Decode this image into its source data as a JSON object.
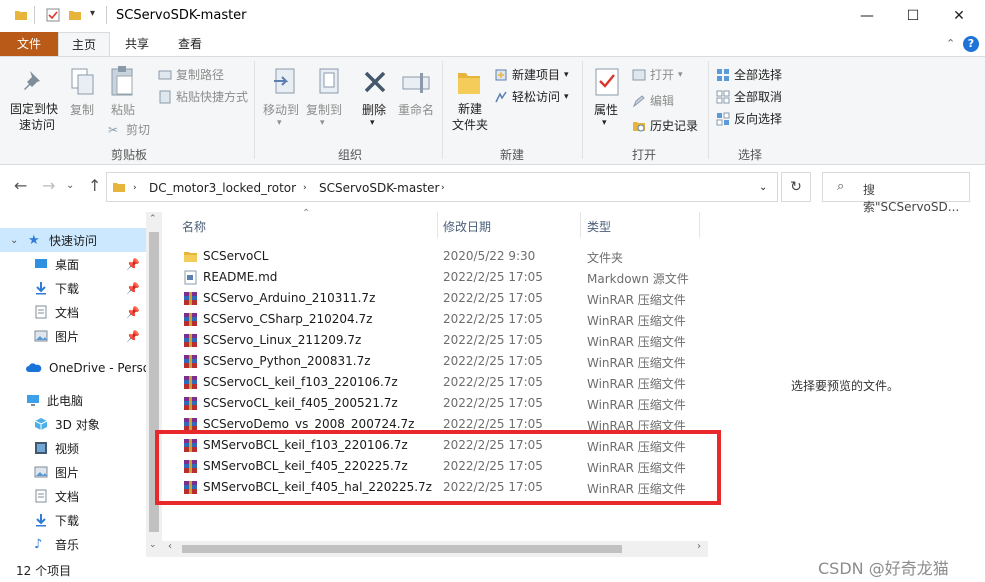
{
  "window": {
    "title": "SCServoSDK-master",
    "minimize": "—",
    "maximize": "☐",
    "close": "✕"
  },
  "ribbon_tabs": {
    "file": "文件",
    "home": "主页",
    "share": "共享",
    "view": "查看"
  },
  "ribbon": {
    "pin_quick_access": [
      "固定到快",
      "速访问"
    ],
    "copy": "复制",
    "paste": "粘贴",
    "copy_path": "复制路径",
    "paste_shortcut": "粘贴快捷方式",
    "cut": "剪切",
    "clipboard_group": "剪贴板",
    "move_to": "移动到",
    "copy_to": "复制到",
    "delete": "删除",
    "rename": "重命名",
    "organize_group": "组织",
    "new_folder": [
      "新建",
      "文件夹"
    ],
    "new_item": "新建项目",
    "easy_access": "轻松访问",
    "new_group": "新建",
    "properties": "属性",
    "open": "打开",
    "edit": "编辑",
    "history": "历史记录",
    "open_group": "打开",
    "select_all": "全部选择",
    "select_none": "全部取消",
    "invert_selection": "反向选择",
    "select_group": "选择"
  },
  "address": {
    "crumb1": "DC_motor3_locked_rotor",
    "crumb2": "SCServoSDK-master",
    "search_placeholder": "搜索\"SCServoSD..."
  },
  "sidebar": {
    "quick_access": "快速访问",
    "desktop": "桌面",
    "downloads": "下载",
    "documents": "文档",
    "pictures": "图片",
    "onedrive": "OneDrive - Perso",
    "this_pc": "此电脑",
    "objects3d": "3D 对象",
    "videos": "视频",
    "pictures2": "图片",
    "documents2": "文档",
    "downloads2": "下载",
    "music": "音乐"
  },
  "columns": {
    "name": "名称",
    "date": "修改日期",
    "type": "类型"
  },
  "files": [
    {
      "name": "SCServoCL",
      "date": "2020/5/22 9:30",
      "type": "文件夹",
      "kind": "folder"
    },
    {
      "name": "README.md",
      "date": "2022/2/25 17:05",
      "type": "Markdown 源文件",
      "kind": "doc"
    },
    {
      "name": "SCServo_Arduino_210311.7z",
      "date": "2022/2/25 17:05",
      "type": "WinRAR 压缩文件",
      "kind": "rar"
    },
    {
      "name": "SCServo_CSharp_210204.7z",
      "date": "2022/2/25 17:05",
      "type": "WinRAR 压缩文件",
      "kind": "rar"
    },
    {
      "name": "SCServo_Linux_211209.7z",
      "date": "2022/2/25 17:05",
      "type": "WinRAR 压缩文件",
      "kind": "rar"
    },
    {
      "name": "SCServo_Python_200831.7z",
      "date": "2022/2/25 17:05",
      "type": "WinRAR 压缩文件",
      "kind": "rar"
    },
    {
      "name": "SCServoCL_keil_f103_220106.7z",
      "date": "2022/2/25 17:05",
      "type": "WinRAR 压缩文件",
      "kind": "rar"
    },
    {
      "name": "SCServoCL_keil_f405_200521.7z",
      "date": "2022/2/25 17:05",
      "type": "WinRAR 压缩文件",
      "kind": "rar"
    },
    {
      "name": "SCServoDemo_vs_2008_200724.7z",
      "date": "2022/2/25 17:05",
      "type": "WinRAR 压缩文件",
      "kind": "rar"
    },
    {
      "name": "SMServoBCL_keil_f103_220106.7z",
      "date": "2022/2/25 17:05",
      "type": "WinRAR 压缩文件",
      "kind": "rar"
    },
    {
      "name": "SMServoBCL_keil_f405_220225.7z",
      "date": "2022/2/25 17:05",
      "type": "WinRAR 压缩文件",
      "kind": "rar"
    },
    {
      "name": "SMServoBCL_keil_f405_hal_220225.7z",
      "date": "2022/2/25 17:05",
      "type": "WinRAR 压缩文件",
      "kind": "rar"
    }
  ],
  "preview_message": "选择要预览的文件。",
  "status": {
    "item_count": "12 个项目"
  },
  "watermark": "CSDN @好奇龙猫",
  "colors": {
    "file_tab": "#b95a18",
    "selection": "#cce8ff",
    "highlight_box": "#e8282b",
    "header_text": "#4c607a"
  }
}
